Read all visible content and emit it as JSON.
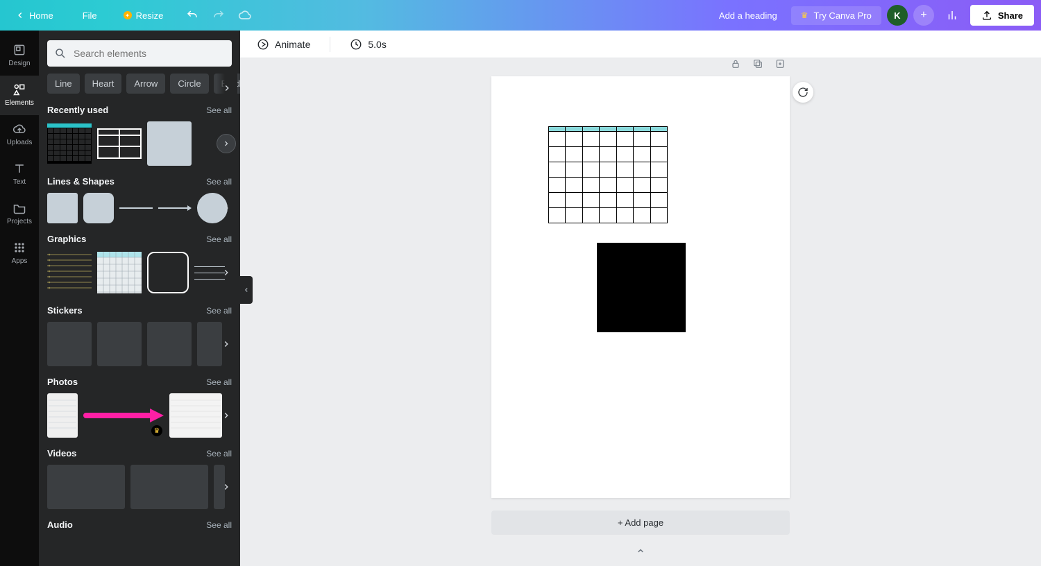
{
  "topbar": {
    "home": "Home",
    "file": "File",
    "resize": "Resize",
    "add_heading": "Add a heading",
    "try_pro": "Try Canva Pro",
    "avatar_initial": "K",
    "share": "Share"
  },
  "rail": {
    "design": "Design",
    "elements": "Elements",
    "uploads": "Uploads",
    "text": "Text",
    "projects": "Projects",
    "apps": "Apps"
  },
  "panel": {
    "search_placeholder": "Search elements",
    "chips": [
      "Line",
      "Heart",
      "Arrow",
      "Circle",
      "Border"
    ],
    "see_all": "See all",
    "sections": {
      "recently_used": "Recently used",
      "lines_shapes": "Lines & Shapes",
      "graphics": "Graphics",
      "stickers": "Stickers",
      "photos": "Photos",
      "videos": "Videos",
      "audio": "Audio"
    }
  },
  "context": {
    "animate": "Animate",
    "duration": "5.0s"
  },
  "canvas": {
    "add_page": "+ Add page"
  }
}
